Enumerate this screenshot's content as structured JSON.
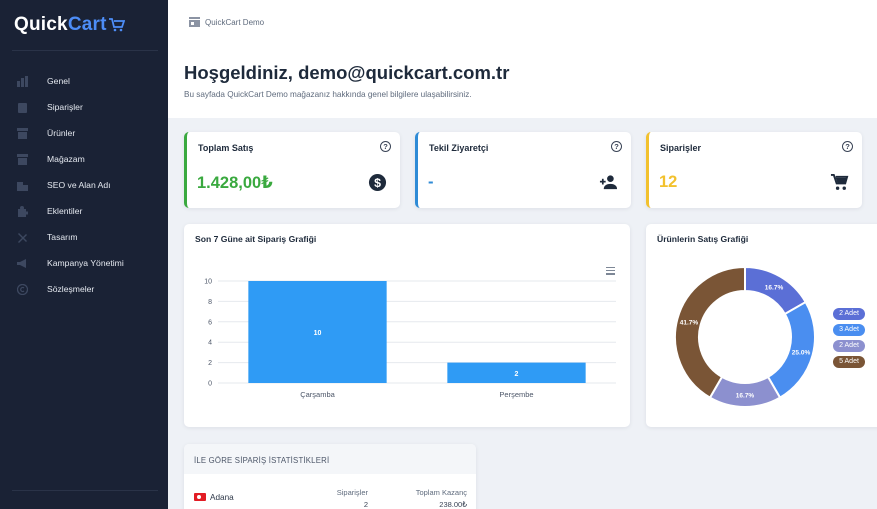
{
  "app": {
    "logo_quick": "Quick",
    "logo_cart": "Cart"
  },
  "sidebar": {
    "items": [
      {
        "label": "Genel",
        "icon": "chart-icon"
      },
      {
        "label": "Siparişler",
        "icon": "clipboard-icon"
      },
      {
        "label": "Ürünler",
        "icon": "box-icon"
      },
      {
        "label": "Mağazam",
        "icon": "store-icon"
      },
      {
        "label": "SEO ve Alan Adı",
        "icon": "building-icon"
      },
      {
        "label": "Eklentiler",
        "icon": "puzzle-icon"
      },
      {
        "label": "Tasarım",
        "icon": "tools-icon"
      },
      {
        "label": "Kampanya Yönetimi",
        "icon": "megaphone-icon"
      },
      {
        "label": "Sözleşmeler",
        "icon": "copyright-icon"
      }
    ]
  },
  "topbar": {
    "breadcrumb": "QuickCart Demo"
  },
  "welcome": {
    "title": "Hoşgeldiniz, demo@quickcart.com.tr",
    "subtitle": "Bu sayfada QuickCart Demo mağazanız hakkında genel bilgilere ulaşabilirsiniz."
  },
  "stats": [
    {
      "title": "Toplam Satış",
      "value": "1.428,00₺",
      "color": "#3aa93f",
      "icon": "dollar-circle-icon"
    },
    {
      "title": "Tekil Ziyaretçi",
      "value": "-",
      "color": "#2f8bd6",
      "icon": "person-add-icon"
    },
    {
      "title": "Siparişler",
      "value": "12",
      "color": "#f2c12e",
      "icon": "cart-icon"
    }
  ],
  "bar_panel": {
    "title": "Son 7 Güne ait Sipariş Grafiği"
  },
  "pie_panel": {
    "title": "Ürünlerin Satış Grafiği"
  },
  "chart_data": [
    {
      "type": "bar",
      "categories": [
        "Çarşamba",
        "Perşembe"
      ],
      "values": [
        10,
        2
      ],
      "yticks": [
        0,
        2,
        4,
        6,
        8,
        10
      ],
      "ylim": [
        0,
        10
      ],
      "color": "#2f9bf5",
      "grid": true
    },
    {
      "type": "pie",
      "donut": true,
      "slices": [
        {
          "value": 16.7,
          "label": "16.7%",
          "legend": "2 Adet",
          "color": "#5b6fd6"
        },
        {
          "value": 25.0,
          "label": "25.0%",
          "legend": "3 Adet",
          "color": "#4a8ef0"
        },
        {
          "value": 16.7,
          "label": "16.7%",
          "legend": "2 Adet",
          "color": "#8c90cf"
        },
        {
          "value": 41.7,
          "label": "41.7%",
          "legend": "5 Adet",
          "color": "#7a5536"
        }
      ]
    }
  ],
  "city_table": {
    "title": "İLE GÖRE SİPARİŞ İSTATİSTİKLERİ",
    "col_orders": "Siparişler",
    "col_revenue": "Toplam Kazanç",
    "rows": [
      {
        "city": "Adana",
        "orders": "2",
        "revenue": "238.00₺"
      }
    ]
  }
}
